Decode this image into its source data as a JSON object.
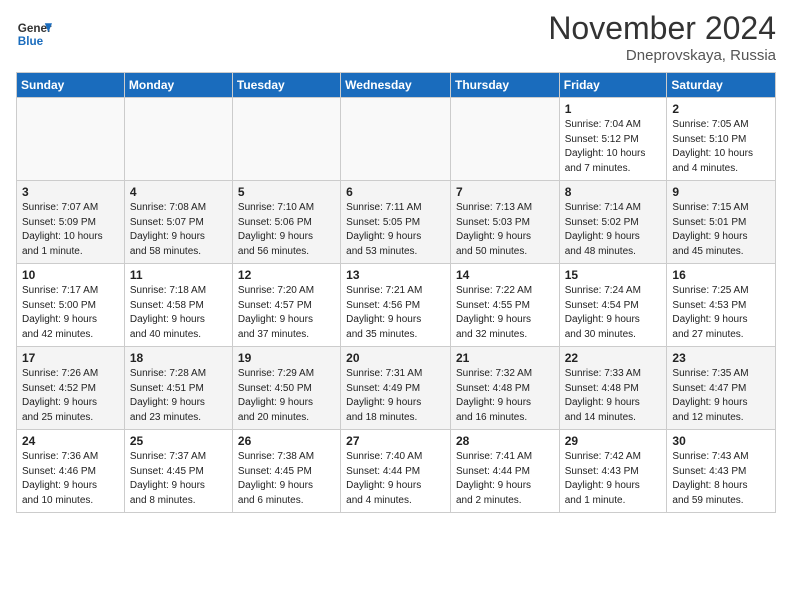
{
  "header": {
    "logo_general": "General",
    "logo_blue": "Blue",
    "title": "November 2024",
    "location": "Dneprovskaya, Russia"
  },
  "days_of_week": [
    "Sunday",
    "Monday",
    "Tuesday",
    "Wednesday",
    "Thursday",
    "Friday",
    "Saturday"
  ],
  "weeks": [
    [
      {
        "day": "",
        "info": ""
      },
      {
        "day": "",
        "info": ""
      },
      {
        "day": "",
        "info": ""
      },
      {
        "day": "",
        "info": ""
      },
      {
        "day": "",
        "info": ""
      },
      {
        "day": "1",
        "info": "Sunrise: 7:04 AM\nSunset: 5:12 PM\nDaylight: 10 hours\nand 7 minutes."
      },
      {
        "day": "2",
        "info": "Sunrise: 7:05 AM\nSunset: 5:10 PM\nDaylight: 10 hours\nand 4 minutes."
      }
    ],
    [
      {
        "day": "3",
        "info": "Sunrise: 7:07 AM\nSunset: 5:09 PM\nDaylight: 10 hours\nand 1 minute."
      },
      {
        "day": "4",
        "info": "Sunrise: 7:08 AM\nSunset: 5:07 PM\nDaylight: 9 hours\nand 58 minutes."
      },
      {
        "day": "5",
        "info": "Sunrise: 7:10 AM\nSunset: 5:06 PM\nDaylight: 9 hours\nand 56 minutes."
      },
      {
        "day": "6",
        "info": "Sunrise: 7:11 AM\nSunset: 5:05 PM\nDaylight: 9 hours\nand 53 minutes."
      },
      {
        "day": "7",
        "info": "Sunrise: 7:13 AM\nSunset: 5:03 PM\nDaylight: 9 hours\nand 50 minutes."
      },
      {
        "day": "8",
        "info": "Sunrise: 7:14 AM\nSunset: 5:02 PM\nDaylight: 9 hours\nand 48 minutes."
      },
      {
        "day": "9",
        "info": "Sunrise: 7:15 AM\nSunset: 5:01 PM\nDaylight: 9 hours\nand 45 minutes."
      }
    ],
    [
      {
        "day": "10",
        "info": "Sunrise: 7:17 AM\nSunset: 5:00 PM\nDaylight: 9 hours\nand 42 minutes."
      },
      {
        "day": "11",
        "info": "Sunrise: 7:18 AM\nSunset: 4:58 PM\nDaylight: 9 hours\nand 40 minutes."
      },
      {
        "day": "12",
        "info": "Sunrise: 7:20 AM\nSunset: 4:57 PM\nDaylight: 9 hours\nand 37 minutes."
      },
      {
        "day": "13",
        "info": "Sunrise: 7:21 AM\nSunset: 4:56 PM\nDaylight: 9 hours\nand 35 minutes."
      },
      {
        "day": "14",
        "info": "Sunrise: 7:22 AM\nSunset: 4:55 PM\nDaylight: 9 hours\nand 32 minutes."
      },
      {
        "day": "15",
        "info": "Sunrise: 7:24 AM\nSunset: 4:54 PM\nDaylight: 9 hours\nand 30 minutes."
      },
      {
        "day": "16",
        "info": "Sunrise: 7:25 AM\nSunset: 4:53 PM\nDaylight: 9 hours\nand 27 minutes."
      }
    ],
    [
      {
        "day": "17",
        "info": "Sunrise: 7:26 AM\nSunset: 4:52 PM\nDaylight: 9 hours\nand 25 minutes."
      },
      {
        "day": "18",
        "info": "Sunrise: 7:28 AM\nSunset: 4:51 PM\nDaylight: 9 hours\nand 23 minutes."
      },
      {
        "day": "19",
        "info": "Sunrise: 7:29 AM\nSunset: 4:50 PM\nDaylight: 9 hours\nand 20 minutes."
      },
      {
        "day": "20",
        "info": "Sunrise: 7:31 AM\nSunset: 4:49 PM\nDaylight: 9 hours\nand 18 minutes."
      },
      {
        "day": "21",
        "info": "Sunrise: 7:32 AM\nSunset: 4:48 PM\nDaylight: 9 hours\nand 16 minutes."
      },
      {
        "day": "22",
        "info": "Sunrise: 7:33 AM\nSunset: 4:48 PM\nDaylight: 9 hours\nand 14 minutes."
      },
      {
        "day": "23",
        "info": "Sunrise: 7:35 AM\nSunset: 4:47 PM\nDaylight: 9 hours\nand 12 minutes."
      }
    ],
    [
      {
        "day": "24",
        "info": "Sunrise: 7:36 AM\nSunset: 4:46 PM\nDaylight: 9 hours\nand 10 minutes."
      },
      {
        "day": "25",
        "info": "Sunrise: 7:37 AM\nSunset: 4:45 PM\nDaylight: 9 hours\nand 8 minutes."
      },
      {
        "day": "26",
        "info": "Sunrise: 7:38 AM\nSunset: 4:45 PM\nDaylight: 9 hours\nand 6 minutes."
      },
      {
        "day": "27",
        "info": "Sunrise: 7:40 AM\nSunset: 4:44 PM\nDaylight: 9 hours\nand 4 minutes."
      },
      {
        "day": "28",
        "info": "Sunrise: 7:41 AM\nSunset: 4:44 PM\nDaylight: 9 hours\nand 2 minutes."
      },
      {
        "day": "29",
        "info": "Sunrise: 7:42 AM\nSunset: 4:43 PM\nDaylight: 9 hours\nand 1 minute."
      },
      {
        "day": "30",
        "info": "Sunrise: 7:43 AM\nSunset: 4:43 PM\nDaylight: 8 hours\nand 59 minutes."
      }
    ]
  ]
}
